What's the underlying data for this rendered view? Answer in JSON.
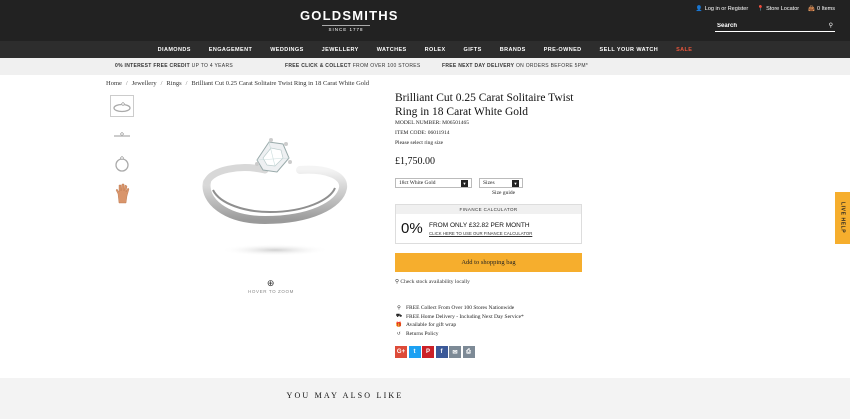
{
  "header": {
    "logo_main": "GOLDSMITHS",
    "logo_since": "SINCE 1778",
    "login_label": "Log in or Register",
    "store_locator_label": "Store Locator",
    "bag_label": "0 Items",
    "search_placeholder": "Search"
  },
  "nav": {
    "items": [
      "DIAMONDS",
      "ENGAGEMENT",
      "WEDDINGS",
      "JEWELLERY",
      "WATCHES",
      "ROLEX",
      "GIFTS",
      "BRANDS",
      "PRE-OWNED",
      "SELL YOUR WATCH",
      "SALE"
    ]
  },
  "promo": {
    "item1_bold": "0% INTEREST FREE CREDIT",
    "item1_rest": " UP TO 4 YEARS",
    "item2_bold": "FREE CLICK & COLLECT",
    "item2_rest": " FROM OVER 100 STORES",
    "item3_bold": "FREE NEXT DAY DELIVERY",
    "item3_rest": " ON ORDERS BEFORE 5PM*"
  },
  "breadcrumb": [
    "Home",
    "Jewellery",
    "Rings",
    "Brilliant Cut 0.25 Carat Solitaire Twist Ring in 18 Carat White Gold"
  ],
  "gallery": {
    "zoom_hint": "HOVER TO ZOOM"
  },
  "product": {
    "title": "Brilliant Cut 0.25 Carat Solitaire Twist Ring in 18 Carat White Gold",
    "model_number": "MODEL NUMBER: M06501465",
    "item_code": "ITEM CODE: 06011914",
    "ring_size_note": "Please select ring size",
    "price": "£1,750.00",
    "metal_select": "18ct White Gold",
    "size_select": "Sizes",
    "size_guide": "Size guide"
  },
  "finance": {
    "header": "FINANCE CALCULATOR",
    "rate": "0%",
    "from_text": "FROM ONLY £32.82 PER MONTH",
    "link_text": "CLICK HERE TO USE OUR FINANCE CALCULATOR"
  },
  "actions": {
    "add_to_bag": "Add to shopping bag",
    "check_stock": "Check stock availability locally"
  },
  "features": [
    "FREE Collect From Over 100 Stores Nationwide",
    "FREE Home Delivery - Including Next Day Service*",
    "Available for gift wrap",
    "Returns Policy"
  ],
  "social": [
    "G+",
    "t",
    "P",
    "f",
    "✉",
    "⎙"
  ],
  "social_colors": [
    "#dd4b39",
    "#1da1f2",
    "#cb2027",
    "#3b5998",
    "#7d8a96",
    "#7d8a96"
  ],
  "live_help": "LIVE HELP",
  "also_like": "YOU MAY ALSO LIKE",
  "colors": {
    "header_bg": "#222222",
    "accent": "#f6ae2d",
    "sale": "#e8553b"
  }
}
